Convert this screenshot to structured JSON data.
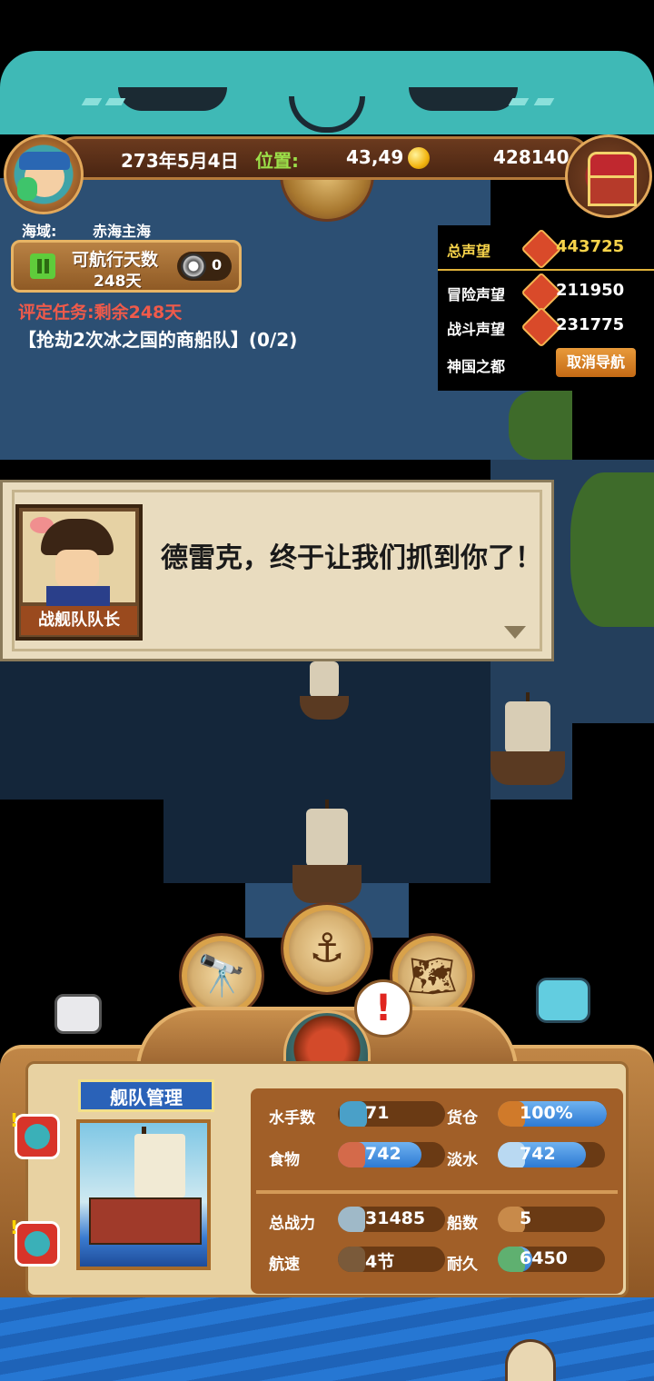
{
  "status": {
    "date": "273年5月4日",
    "location_label": "位置:",
    "location_value": "43,49",
    "gold": "428140"
  },
  "region": {
    "label": "海域:",
    "value": "赤海主海"
  },
  "navigation": {
    "days_label": "可航行天数",
    "days_value": "248天",
    "coin_count": "0"
  },
  "mission": {
    "eval_task": "评定任务:剩余248天",
    "objective": "【抢劫2次冰之国的商船队】(0/2)"
  },
  "reputation": {
    "total_label": "总声望",
    "total_value": "443725",
    "adventure_label": "冒险声望",
    "adventure_value": "211950",
    "battle_label": "战斗声望",
    "battle_value": "231775",
    "destination": "神国之都",
    "cancel_nav_label": "取消导航"
  },
  "dialog": {
    "speaker": "战舰队队长",
    "text": "德雷克，终于让我们抓到你了！"
  },
  "actions": {
    "alert_symbol": "!",
    "icons": [
      "telescope-icon",
      "anchor-icon",
      "world-map-icon"
    ]
  },
  "fleet": {
    "title": "舰队管理",
    "stats": {
      "sailors_label": "水手数",
      "sailors_value": "71",
      "cargo_label": "货仓",
      "cargo_value": "100%",
      "cargo_fill": 1.0,
      "food_label": "食物",
      "food_value": "742",
      "food_fill": 0.78,
      "water_label": "淡水",
      "water_value": "742",
      "water_fill": 0.82,
      "power_label": "总战力",
      "power_value": "31485",
      "ships_label": "船数",
      "ships_value": "5",
      "speed_label": "航速",
      "speed_value": "4节",
      "durability_label": "耐久",
      "durability_value": "6450",
      "durability_fill": 0.32
    }
  },
  "colors": {
    "accent_green": "#9be049",
    "gold": "#f2b40f",
    "mission_red": "#f05a4a",
    "bar_blue": "#2d7ad4",
    "panel_brown": "#a15f28"
  }
}
